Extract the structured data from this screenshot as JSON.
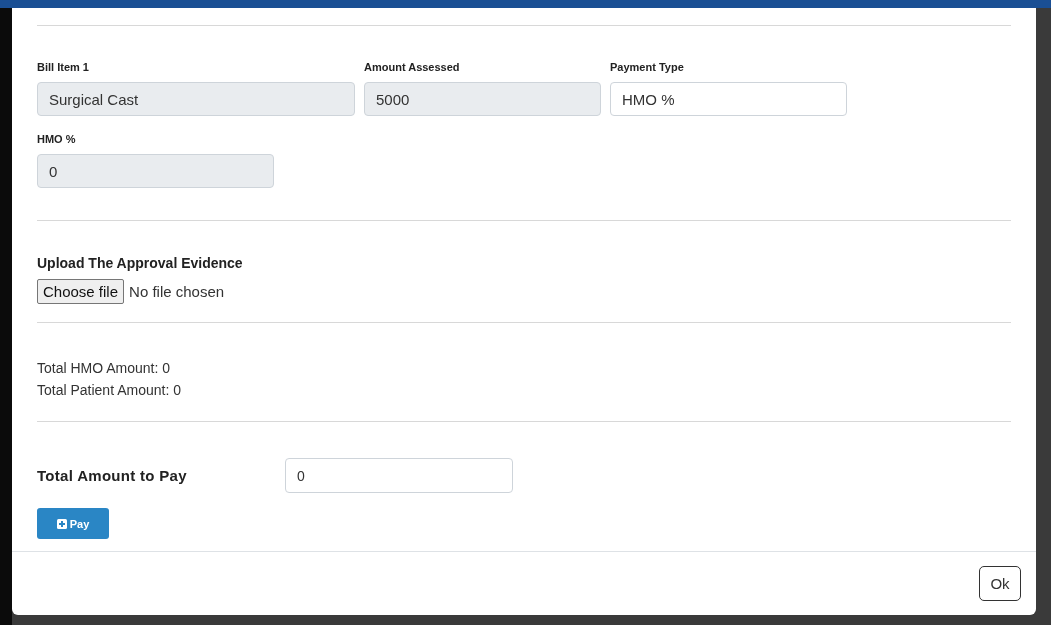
{
  "fields_row_1": [
    {
      "label": "Bill Item 1",
      "value": "Surgical Cast",
      "disabled": true
    },
    {
      "label": "Amount Assessed",
      "value": "5000",
      "disabled": true
    },
    {
      "label": "Payment Type",
      "value": "HMO %",
      "disabled": false
    }
  ],
  "fields_row_2": [
    {
      "label": "HMO %",
      "value": "0",
      "disabled": true
    }
  ],
  "upload": {
    "label": "Upload The Approval Evidence",
    "button": "Choose file",
    "status": "No file chosen"
  },
  "totals": [
    "Total HMO Amount: 0",
    "Total Patient Amount: 0"
  ],
  "total_to_pay": {
    "label": "Total Amount to Pay",
    "value": "0"
  },
  "pay_button": {
    "label": "Pay"
  },
  "footer": {
    "ok_button": "Ok"
  }
}
